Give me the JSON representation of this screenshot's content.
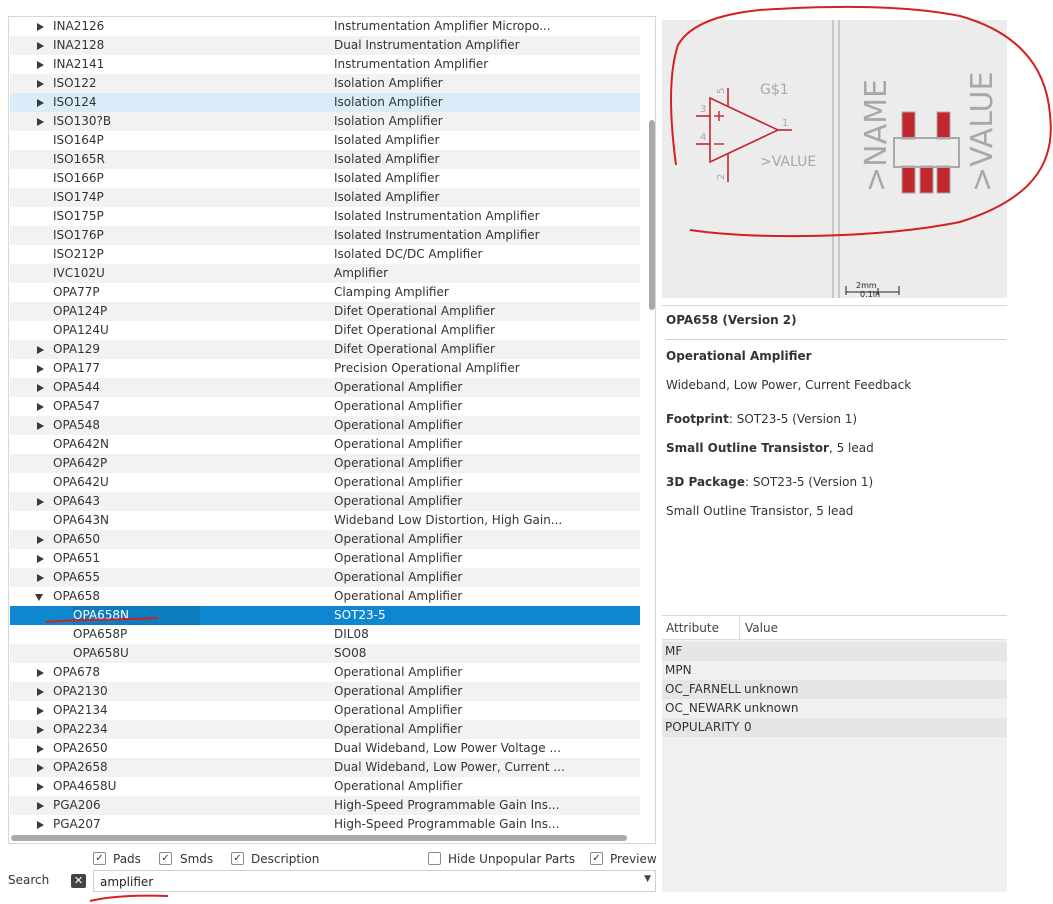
{
  "tree": {
    "rows": [
      {
        "name": "INA2126",
        "desc": "Instrumentation Amplifier Micropo...",
        "expand": "collapsed"
      },
      {
        "name": "INA2128",
        "desc": "Dual Instrumentation Amplifier",
        "expand": "collapsed"
      },
      {
        "name": "INA2141",
        "desc": "Instrumentation Amplifier",
        "expand": "collapsed"
      },
      {
        "name": "ISO122",
        "desc": "Isolation Amplifier",
        "expand": "collapsed"
      },
      {
        "name": "ISO124",
        "desc": "Isolation Amplifier",
        "expand": "collapsed",
        "hover": true
      },
      {
        "name": "ISO130?B",
        "desc": "Isolation Amplifier",
        "expand": "collapsed"
      },
      {
        "name": "ISO164P",
        "desc": "Isolated Amplifier",
        "expand": "none"
      },
      {
        "name": "ISO165R",
        "desc": "Isolated Amplifier",
        "expand": "none"
      },
      {
        "name": "ISO166P",
        "desc": "Isolated Amplifier",
        "expand": "none"
      },
      {
        "name": "ISO174P",
        "desc": "Isolated Amplifier",
        "expand": "none"
      },
      {
        "name": "ISO175P",
        "desc": "Isolated Instrumentation Amplifier",
        "expand": "none"
      },
      {
        "name": "ISO176P",
        "desc": "Isolated Instrumentation Amplifier",
        "expand": "none"
      },
      {
        "name": "ISO212P",
        "desc": "Isolated DC/DC Amplifier",
        "expand": "none"
      },
      {
        "name": "IVC102U",
        "desc": "Amplifier",
        "expand": "none"
      },
      {
        "name": "OPA77P",
        "desc": "Clamping Amplifier",
        "expand": "none"
      },
      {
        "name": "OPA124P",
        "desc": "Difet Operational Amplifier",
        "expand": "none"
      },
      {
        "name": "OPA124U",
        "desc": "Difet Operational Amplifier",
        "expand": "none"
      },
      {
        "name": "OPA129",
        "desc": "Difet Operational Amplifier",
        "expand": "collapsed"
      },
      {
        "name": "OPA177",
        "desc": "Precision Operational Amplifier",
        "expand": "collapsed"
      },
      {
        "name": "OPA544",
        "desc": "Operational Amplifier",
        "expand": "collapsed"
      },
      {
        "name": "OPA547",
        "desc": "Operational Amplifier",
        "expand": "collapsed"
      },
      {
        "name": "OPA548",
        "desc": "Operational Amplifier",
        "expand": "collapsed"
      },
      {
        "name": "OPA642N",
        "desc": "Operational Amplifier",
        "expand": "none"
      },
      {
        "name": "OPA642P",
        "desc": "Operational Amplifier",
        "expand": "none"
      },
      {
        "name": "OPA642U",
        "desc": "Operational Amplifier",
        "expand": "none"
      },
      {
        "name": "OPA643",
        "desc": "Operational Amplifier",
        "expand": "collapsed"
      },
      {
        "name": "OPA643N",
        "desc": "Wideband Low Distortion, High Gain...",
        "expand": "none"
      },
      {
        "name": "OPA650",
        "desc": "Operational Amplifier",
        "expand": "collapsed"
      },
      {
        "name": "OPA651",
        "desc": "Operational Amplifier",
        "expand": "collapsed"
      },
      {
        "name": "OPA655",
        "desc": "Operational Amplifier",
        "expand": "collapsed"
      },
      {
        "name": "OPA658",
        "desc": "Operational Amplifier",
        "expand": "expanded"
      },
      {
        "name": "OPA658N",
        "desc": "SOT23-5",
        "expand": "child",
        "selected": true
      },
      {
        "name": "OPA658P",
        "desc": "DIL08",
        "expand": "child"
      },
      {
        "name": "OPA658U",
        "desc": "SO08",
        "expand": "child"
      },
      {
        "name": "OPA678",
        "desc": "Operational Amplifier",
        "expand": "collapsed"
      },
      {
        "name": "OPA2130",
        "desc": "Operational Amplifier",
        "expand": "collapsed"
      },
      {
        "name": "OPA2134",
        "desc": "Operational Amplifier",
        "expand": "collapsed"
      },
      {
        "name": "OPA2234",
        "desc": "Operational Amplifier",
        "expand": "collapsed"
      },
      {
        "name": "OPA2650",
        "desc": "Dual Wideband, Low Power Voltage ...",
        "expand": "collapsed"
      },
      {
        "name": "OPA2658",
        "desc": "Dual Wideband, Low Power, Current ...",
        "expand": "collapsed"
      },
      {
        "name": "OPA4658U",
        "desc": "Operational Amplifier",
        "expand": "collapsed"
      },
      {
        "name": "PGA206",
        "desc": "High-Speed Programmable Gain Ins...",
        "expand": "collapsed"
      },
      {
        "name": "PGA207",
        "desc": "High-Speed Programmable Gain Ins...",
        "expand": "collapsed"
      }
    ]
  },
  "options": {
    "pads": {
      "label": "Pads",
      "checked": true
    },
    "smds": {
      "label": "Smds",
      "checked": true
    },
    "description": {
      "label": "Description",
      "checked": true
    },
    "hide_unpopular": {
      "label": "Hide Unpopular Parts",
      "checked": false
    },
    "preview": {
      "label": "Preview",
      "checked": true
    }
  },
  "search": {
    "label": "Search",
    "value": "amplifier",
    "clear_icon": "clear-x-icon",
    "dropdown_icon": "chevron-down-icon"
  },
  "symbol": {
    "name_text": "G$1",
    "value_text": ">VALUE",
    "pins": [
      "1",
      "2",
      "3",
      "4",
      "5"
    ]
  },
  "package": {
    "name_text": ">NAME",
    "value_text": ">VALUE",
    "scale_mm": "2mm",
    "scale_in": "0.1in"
  },
  "info": {
    "title": "OPA658 (Version 2)",
    "heading": "Operational Amplifier",
    "subtitle": "Wideband, Low Power, Current Feedback",
    "footprint_label": "Footprint",
    "footprint_value": ": SOT23-5 (Version 1)",
    "footprint_desc_bold": "Small Outline Transistor",
    "footprint_desc_rest": ", 5 lead",
    "package3d_label": "3D Package",
    "package3d_value": ": SOT23-5 (Version 1)",
    "package3d_desc": "Small Outline Transistor, 5 lead"
  },
  "attributes": {
    "header_attr": "Attribute",
    "header_value": "Value",
    "rows": [
      {
        "key": "MF",
        "value": ""
      },
      {
        "key": "MPN",
        "value": ""
      },
      {
        "key": "OC_FARNELL",
        "value": "unknown"
      },
      {
        "key": "OC_NEWARK",
        "value": "unknown"
      },
      {
        "key": "POPULARITY",
        "value": "0"
      }
    ]
  },
  "colors": {
    "selection": "#0e87d0",
    "hover_row": "#d9ecf8",
    "annotation": "#d42020",
    "schematic_red": "#c0282e",
    "schematic_gray": "#a8a8a8"
  }
}
